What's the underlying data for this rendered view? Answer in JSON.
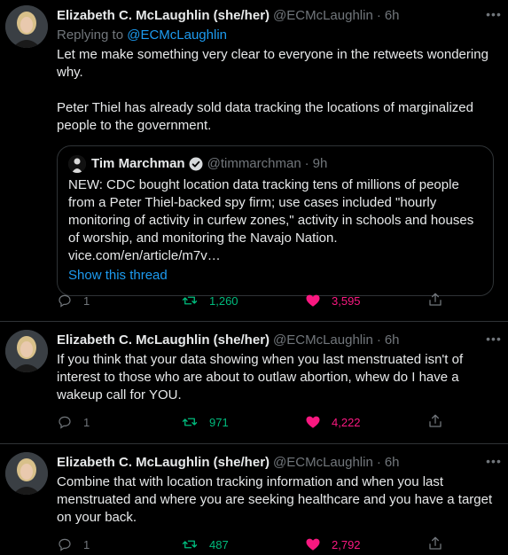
{
  "tweets": [
    {
      "author": {
        "name": "Elizabeth C. McLaughlin (she/her)",
        "handle": "@ECMcLaughlin",
        "time": "6h"
      },
      "reply_to": {
        "prefix": "Replying to",
        "handle": "@ECMcLaughlin"
      },
      "paragraphs": [
        "Let me make something very clear to everyone in the retweets wondering why.",
        "Peter Thiel has already sold data tracking the locations of marginalized people to the government."
      ],
      "quote": {
        "author": {
          "name": "Tim Marchman",
          "handle": "@timmarchman",
          "time": "9h"
        },
        "text": "NEW: CDC bought location data tracking tens of millions of people from a Peter Thiel-backed spy firm; use cases included \"hourly monitoring of activity in curfew zones,\" activity in schools and houses of worship, and monitoring the Navajo Nation. vice.com/en/article/m7v…",
        "show_thread": "Show this thread"
      },
      "stats": {
        "replies": "1",
        "retweets": "1,260",
        "likes": "3,595"
      }
    },
    {
      "author": {
        "name": "Elizabeth C. McLaughlin (she/her)",
        "handle": "@ECMcLaughlin",
        "time": "6h"
      },
      "text": "If you think that your data showing when you last menstruated isn't of interest to those who are about to outlaw abortion, whew do I have a wakeup call for YOU.",
      "stats": {
        "replies": "1",
        "retweets": "971",
        "likes": "4,222"
      }
    },
    {
      "author": {
        "name": "Elizabeth C. McLaughlin (she/her)",
        "handle": "@ECMcLaughlin",
        "time": "6h"
      },
      "text": "Combine that with location tracking information and when you last menstruated and where you are seeking healthcare and you have a target on your back.",
      "stats": {
        "replies": "1",
        "retweets": "487",
        "likes": "2,792"
      }
    }
  ],
  "icons": {
    "more": "more-horizontal-icon",
    "reply": "reply-icon",
    "retweet": "retweet-icon",
    "like": "heart-icon",
    "share": "share-icon",
    "verified": "verified-badge-icon"
  },
  "colors": {
    "background": "#000000",
    "text": "#e7e9ea",
    "muted": "#71767b",
    "link": "#1d9bf0",
    "retweet": "#00ba7c",
    "like": "#f91880",
    "border": "#2f3336"
  }
}
